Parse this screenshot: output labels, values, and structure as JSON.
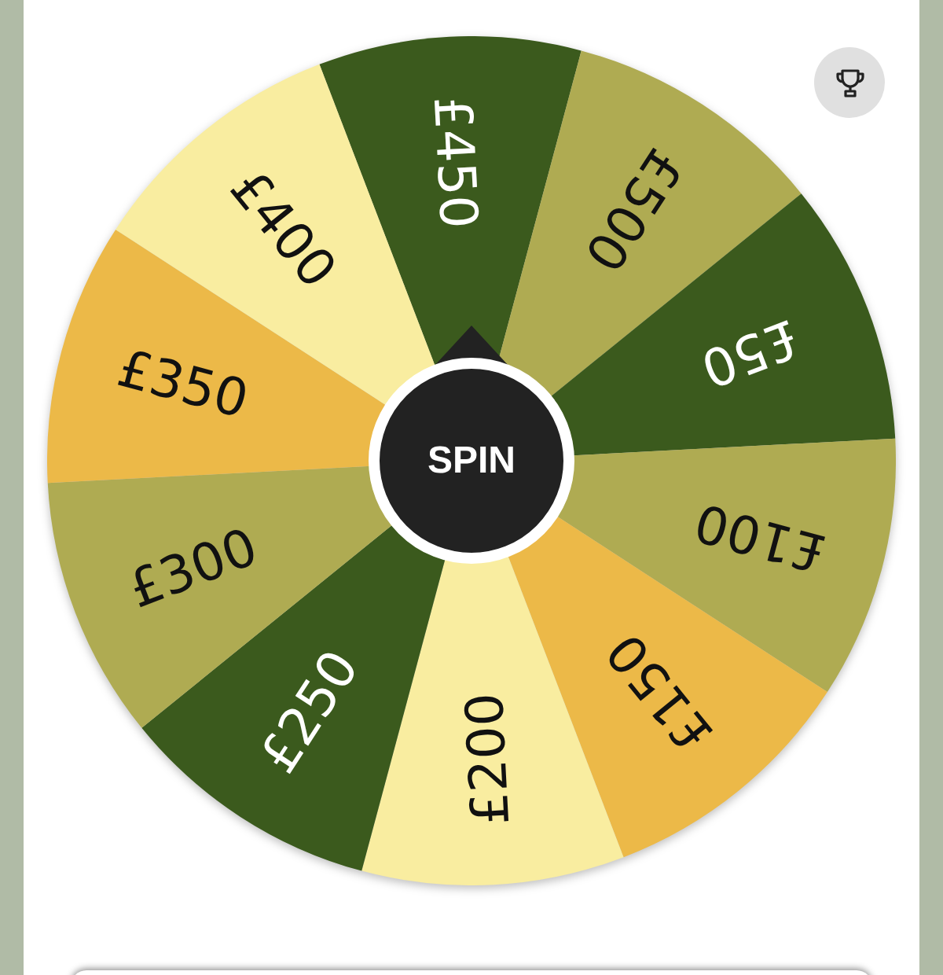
{
  "wheel": {
    "segments": [
      {
        "label": "£450",
        "color": "#3b5a1d"
      },
      {
        "label": "£500",
        "color": "#afab52"
      },
      {
        "label": "£50",
        "color": "#3b5a1d"
      },
      {
        "label": "£100",
        "color": "#afab52"
      },
      {
        "label": "£150",
        "color": "#ecb948"
      },
      {
        "label": "£200",
        "color": "#f9eda0"
      },
      {
        "label": "£250",
        "color": "#3b5a1d"
      },
      {
        "label": "£300",
        "color": "#afab52"
      },
      {
        "label": "£350",
        "color": "#ecb948"
      },
      {
        "label": "£400",
        "color": "#f9eda0"
      }
    ],
    "spin_button": "SPIN"
  }
}
